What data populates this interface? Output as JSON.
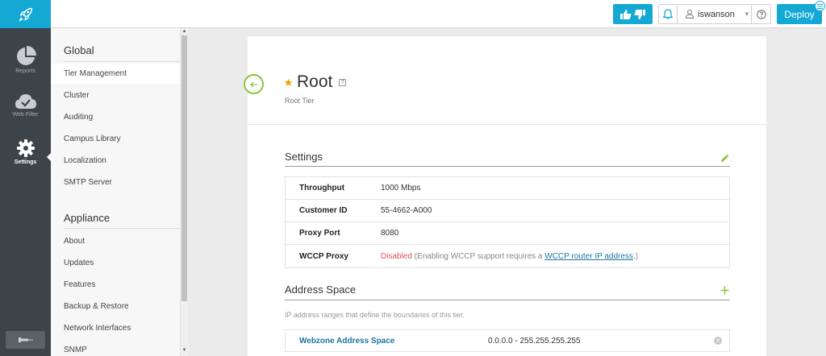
{
  "topbar": {
    "user": "iswanson",
    "deploy_label": "Deploy"
  },
  "rail": {
    "items": [
      {
        "label": "Reports",
        "icon": "pie-chart-icon"
      },
      {
        "label": "Web Filter",
        "icon": "cloud-check-icon"
      },
      {
        "label": "Settings",
        "icon": "gear-icon",
        "active": true
      }
    ]
  },
  "submenu": {
    "global_heading": "Global",
    "global_items": [
      "Tier Management",
      "Cluster",
      "Auditing",
      "Campus Library",
      "Localization",
      "SMTP Server"
    ],
    "appliance_heading": "Appliance",
    "appliance_items": [
      "About",
      "Updates",
      "Features",
      "Backup & Restore",
      "Network Interfaces",
      "SNMP"
    ]
  },
  "page": {
    "title": "Root",
    "subtitle": "Root Tier"
  },
  "settings": {
    "title": "Settings",
    "rows": [
      {
        "key": "Throughput",
        "value": "1000 Mbps"
      },
      {
        "key": "Customer ID",
        "value": "55-4662-A000"
      },
      {
        "key": "Proxy Port",
        "value": "8080"
      }
    ],
    "wccp": {
      "key": "WCCP Proxy",
      "status": "Disabled",
      "note_prefix": "(Enabling WCCP support requires a",
      "link": "WCCP router IP address",
      "note_suffix": ".)"
    }
  },
  "address_space": {
    "title": "Address Space",
    "description": "IP address ranges that define the boundaries of this tier.",
    "rows": [
      {
        "name": "Webzone Address Space",
        "range": "0.0.0.0 - 255.255.255.255"
      }
    ]
  },
  "colors": {
    "accent": "#14a9d5",
    "rail": "#3d4449",
    "green": "#8cc63f",
    "disabled": "#d9534f",
    "star": "#f0a500"
  }
}
